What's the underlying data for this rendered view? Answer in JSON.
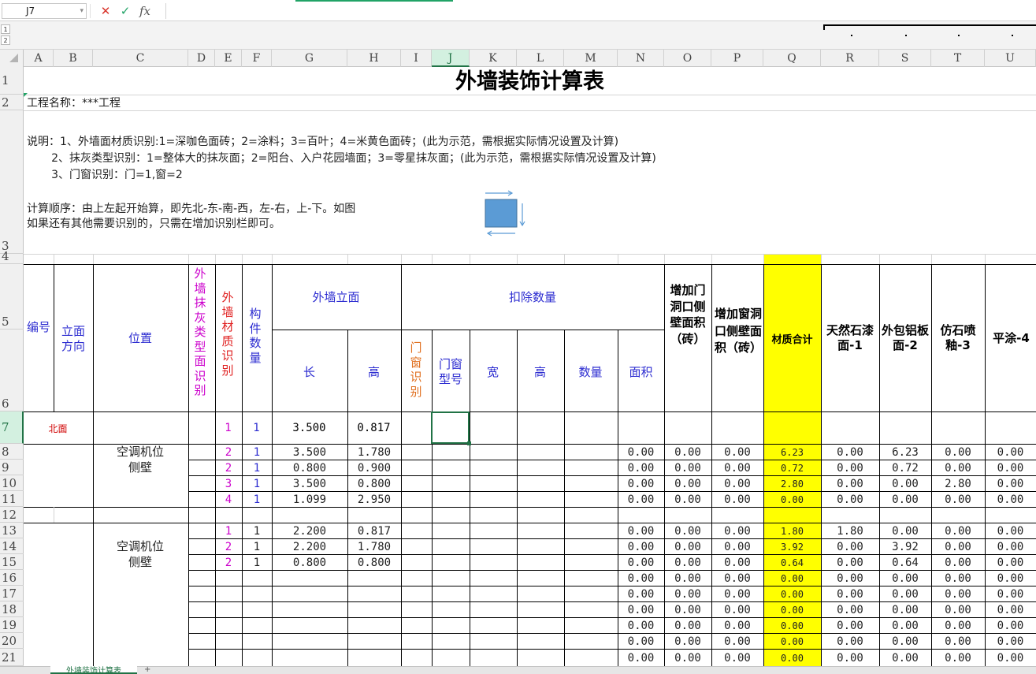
{
  "formula_bar": {
    "name_box": "J7",
    "cancel_icon": "✕",
    "enter_icon": "✓",
    "fx_label": "fx",
    "formula_value": ""
  },
  "outline": {
    "levels": [
      "1",
      "2"
    ]
  },
  "columns": [
    "A",
    "B",
    "C",
    "D",
    "E",
    "F",
    "G",
    "H",
    "I",
    "J",
    "K",
    "L",
    "M",
    "N",
    "O",
    "P",
    "Q",
    "R",
    "S",
    "T",
    "U"
  ],
  "selected_column": "J",
  "rows": [
    "1",
    "2",
    "3",
    "4",
    "5",
    "6",
    "7",
    "8",
    "9",
    "10",
    "11",
    "12",
    "13",
    "14",
    "15",
    "16",
    "17",
    "18",
    "19",
    "20",
    "21"
  ],
  "selected_row": "7",
  "sheet": {
    "title": "外墙装饰计算表",
    "project": "工程名称：***工程",
    "notes": [
      "说明：1、外墙面材质识别:1=深咖色面砖；2=涂料；3=百叶；4=米黄色面砖；(此为示范，需根据实际情况设置及计算)",
      "       2、抹灰类型识别：1=整体大的抹灰面；2=阳台、入户花园墙面；3=零星抹灰面；(此为示范，需根据实际情况设置及计算)",
      "       3、门窗识别：门=1,窗=2"
    ],
    "order_note_1": "计算顺序：由上左起开始算，即先北-东-南-西，左-右，上-下。如图",
    "order_note_2": "如果还有其他需要识别的，只需在增加识别栏即可。",
    "headers": {
      "no": "编号",
      "direction": "立面方向",
      "position": "位置",
      "plaster_type": "外墙抹灰类型面识别",
      "material": "外墙材质识别",
      "count": "构件数量",
      "facade": "外墙立面",
      "length": "长",
      "height": "高",
      "deduct": "扣除数量",
      "door_window": "门窗识别",
      "dw_type": "门窗型号",
      "width": "宽",
      "d_height": "高",
      "quantity": "数量",
      "area": "面积",
      "add_door_side": "增加门洞口侧壁面积（砖）",
      "add_window_side": "增加窗洞口侧壁面积（砖）",
      "material_total": "材质合计",
      "stone_paint": "天然石漆面-1",
      "aluminum": "外包铝板面-2",
      "faux_stone": "仿石喷釉-3",
      "flat_paint": "平涂-4"
    },
    "row7": {
      "direction": "北面",
      "material": "1",
      "count": "1",
      "length": "3.500",
      "height": "0.817"
    },
    "group1_label": [
      "空调机位",
      "侧壁"
    ],
    "group2_label": [
      "空调机位",
      "侧壁"
    ],
    "data_rows": [
      {
        "row": "8",
        "material": "2",
        "count": "1",
        "length": "3.500",
        "height": "1.780",
        "area": "0.00",
        "add_door": "0.00",
        "add_win": "0.00",
        "total": "6.23",
        "r": "0.00",
        "s": "6.23",
        "t": "0.00",
        "u": "0.00"
      },
      {
        "row": "9",
        "material": "2",
        "count": "1",
        "length": "0.800",
        "height": "0.900",
        "area": "0.00",
        "add_door": "0.00",
        "add_win": "0.00",
        "total": "0.72",
        "r": "0.00",
        "s": "0.72",
        "t": "0.00",
        "u": "0.00"
      },
      {
        "row": "10",
        "material": "3",
        "count": "1",
        "length": "3.500",
        "height": "0.800",
        "area": "0.00",
        "add_door": "0.00",
        "add_win": "0.00",
        "total": "2.80",
        "r": "0.00",
        "s": "0.00",
        "t": "2.80",
        "u": "0.00"
      },
      {
        "row": "11",
        "material": "4",
        "count": "1",
        "length": "1.099",
        "height": "2.950",
        "area": "0.00",
        "add_door": "0.00",
        "add_win": "0.00",
        "total": "0.00",
        "r": "0.00",
        "s": "0.00",
        "t": "0.00",
        "u": "0.00"
      },
      {
        "row": "12",
        "material": "",
        "count": "",
        "length": "",
        "height": "",
        "area": "",
        "add_door": "",
        "add_win": "",
        "total": "",
        "r": "",
        "s": "",
        "t": "",
        "u": ""
      },
      {
        "row": "13",
        "material": "1",
        "count": "1",
        "length": "2.200",
        "height": "0.817",
        "area": "0.00",
        "add_door": "0.00",
        "add_win": "0.00",
        "total": "1.80",
        "r": "1.80",
        "s": "0.00",
        "t": "0.00",
        "u": "0.00"
      },
      {
        "row": "14",
        "material": "2",
        "count": "1",
        "length": "2.200",
        "height": "1.780",
        "area": "0.00",
        "add_door": "0.00",
        "add_win": "0.00",
        "total": "3.92",
        "r": "0.00",
        "s": "3.92",
        "t": "0.00",
        "u": "0.00"
      },
      {
        "row": "15",
        "material": "2",
        "count": "1",
        "length": "0.800",
        "height": "0.800",
        "area": "0.00",
        "add_door": "0.00",
        "add_win": "0.00",
        "total": "0.64",
        "r": "0.00",
        "s": "0.64",
        "t": "0.00",
        "u": "0.00"
      },
      {
        "row": "16",
        "material": "",
        "count": "",
        "length": "",
        "height": "",
        "area": "0.00",
        "add_door": "0.00",
        "add_win": "0.00",
        "total": "0.00",
        "r": "0.00",
        "s": "0.00",
        "t": "0.00",
        "u": "0.00"
      },
      {
        "row": "17",
        "material": "",
        "count": "",
        "length": "",
        "height": "",
        "area": "0.00",
        "add_door": "0.00",
        "add_win": "0.00",
        "total": "0.00",
        "r": "0.00",
        "s": "0.00",
        "t": "0.00",
        "u": "0.00"
      },
      {
        "row": "18",
        "material": "",
        "count": "",
        "length": "",
        "height": "",
        "area": "0.00",
        "add_door": "0.00",
        "add_win": "0.00",
        "total": "0.00",
        "r": "0.00",
        "s": "0.00",
        "t": "0.00",
        "u": "0.00"
      },
      {
        "row": "19",
        "material": "",
        "count": "",
        "length": "",
        "height": "",
        "area": "0.00",
        "add_door": "0.00",
        "add_win": "0.00",
        "total": "0.00",
        "r": "0.00",
        "s": "0.00",
        "t": "0.00",
        "u": "0.00"
      },
      {
        "row": "20",
        "material": "",
        "count": "",
        "length": "",
        "height": "",
        "area": "0.00",
        "add_door": "0.00",
        "add_win": "0.00",
        "total": "0.00",
        "r": "0.00",
        "s": "0.00",
        "t": "0.00",
        "u": "0.00"
      },
      {
        "row": "21",
        "material": "",
        "count": "",
        "length": "",
        "height": "",
        "area": "0.00",
        "add_door": "0.00",
        "add_win": "0.00",
        "total": "0.00",
        "r": "0.00",
        "s": "0.00",
        "t": "0.00",
        "u": "0.00"
      }
    ]
  },
  "tabs": {
    "sheet_name": "外墙装饰计算表",
    "add_icon": "+"
  },
  "colors": {
    "highlight_yellow": "#ffff00",
    "selection_green": "#217346",
    "header_blue": "#2b2bd0",
    "material_magenta": "#cc00cc",
    "material_red": "#e02020",
    "door_window_orange": "#e07020",
    "direction_red": "#d00000"
  }
}
